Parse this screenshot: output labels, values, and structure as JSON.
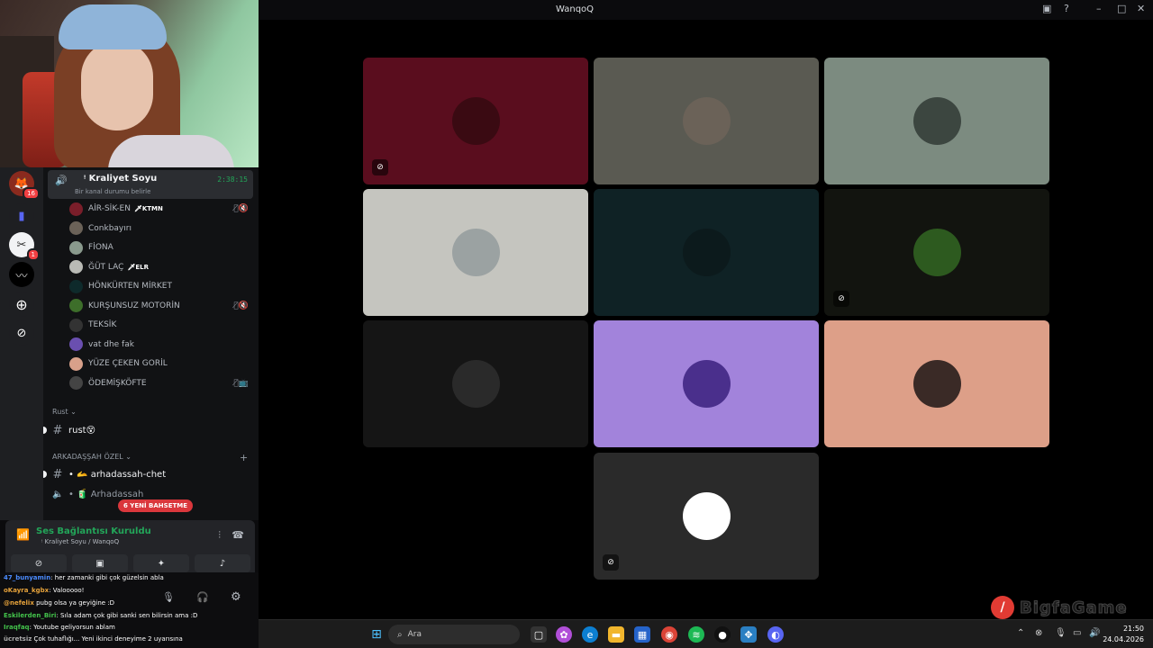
{
  "window": {
    "title": "WanqoQ"
  },
  "voice_header": {
    "channel": "ᵎ Kraliyet Soyu",
    "status": "Bir kanal durumu belirle",
    "timer": "2:38:15"
  },
  "members": [
    {
      "name": "AİR-SİK-EN",
      "tag": "🗡KTMN",
      "icons": "🎙̸🔇",
      "color": "#7a1e2a"
    },
    {
      "name": "Conkbayırı",
      "tag": "",
      "icons": "",
      "color": "#6b6258"
    },
    {
      "name": "FİONA",
      "tag": "",
      "icons": "",
      "color": "#8a9a8d"
    },
    {
      "name": "ĞÜT LAÇ",
      "tag": "🗡ELR",
      "icons": "",
      "color": "#b9bab5"
    },
    {
      "name": "HÖNKÜRTEN MİRKET",
      "tag": "",
      "icons": "",
      "color": "#0e2a2b"
    },
    {
      "name": "KURŞUNSUZ MOTORİN",
      "tag": "",
      "icons": "🎙̸🔇",
      "color": "#3d6e2a"
    },
    {
      "name": "TEKSİK",
      "tag": "",
      "icons": "",
      "color": "#333"
    },
    {
      "name": "vat dhe fak",
      "tag": "",
      "icons": "",
      "color": "#6a4fb0"
    },
    {
      "name": "YÜZE ÇEKEN GORİL",
      "tag": "",
      "icons": "",
      "color": "#d8a08a"
    },
    {
      "name": "ÖDEMİŞKÖFTE",
      "tag": "",
      "icons": "🎙̸📺",
      "color": "#444"
    }
  ],
  "categories": {
    "rust": "Rust ⌄",
    "arkadas": "ARKADAŞŞAH ÖZEL ⌄",
    "add": "+"
  },
  "channels": {
    "rust": "rust😵",
    "chet": "• 🫴 arhadassah-chet",
    "voice": "• 🧃 Arhadassah"
  },
  "mention_pill": "6 YENİ BAHSETME",
  "voice_panel": {
    "title": "Ses Bağlantısı Kuruldu",
    "sub": "ᵎ Kraliyet Soyu / WanqoQ"
  },
  "chat": [
    {
      "user": "47_bunyamin",
      "text": ": her zamanki gibi çok güzelsin abla",
      "color": "#4b8cff"
    },
    {
      "user": "oKayra_kgbx",
      "text": ": Valooooo!",
      "color": "#e7a33b"
    },
    {
      "user": "@nefelix",
      "text": " pubg olsa ya geyiğine :D",
      "color": "#e7a33b"
    },
    {
      "user": "Eskilerden_Biri",
      "text": ": Sıla adam çok gibi sanki sen bilirsin ama :D",
      "color": "#43c24b"
    },
    {
      "user": "Iraqfaq",
      "text": ": Youtube geliyorsun ablam",
      "color": "#43c24b"
    },
    {
      "user": "ücretsiz",
      "text": " Çok tuhaflığı... Yeni ikinci deneyime 2 uyarısına",
      "color": "#aaa"
    }
  ],
  "tiles": [
    {
      "bg": "#5a0d1e",
      "ava": "#3a0a12",
      "muted": true
    },
    {
      "bg": "#5a5a52",
      "ava": "#6b6258",
      "muted": false
    },
    {
      "bg": "#7c8b80",
      "ava": "#3c4640",
      "muted": false
    },
    {
      "bg": "#c5c5bf",
      "ava": "#9ba2a2",
      "muted": false
    },
    {
      "bg": "#0f2225",
      "ava": "#0c1a1c",
      "muted": false
    },
    {
      "bg": "#12140f",
      "ava": "#2d5a1f",
      "muted": true
    },
    {
      "bg": "#151515",
      "ava": "#2a2a2a",
      "muted": false
    },
    {
      "bg": "#a283db",
      "ava": "#4a2f8c",
      "muted": false
    },
    {
      "bg": "#dd9f88",
      "ava": "#3a2a26",
      "muted": false
    },
    {
      "bg": "#2a2a2a",
      "ava": "#ffffff",
      "muted": true
    }
  ],
  "taskbar": {
    "search": "Ara",
    "time": "21:50",
    "date": "24.04.2026"
  },
  "watermark": "BigfaGame",
  "icons": {
    "mute": "🎙̸",
    "deafen": "🎧",
    "settings": "⚙",
    "hangup": "☎",
    "soundboard": "♫",
    "camera": "📷",
    "screen": "🖥",
    "activity": "🎮",
    "emoji": "✨"
  }
}
